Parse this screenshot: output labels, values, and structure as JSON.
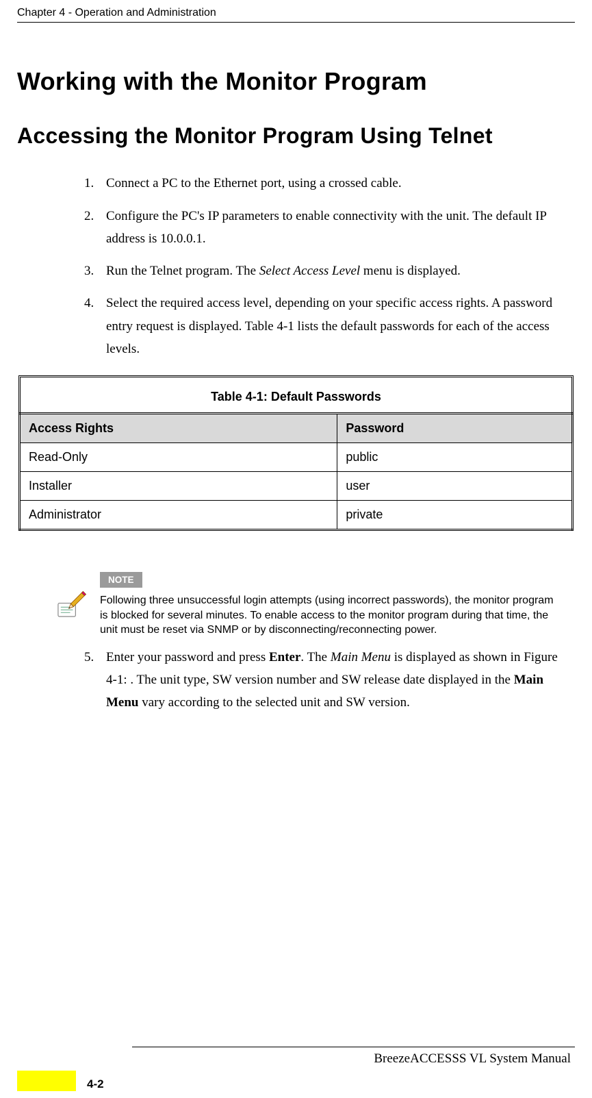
{
  "header": {
    "chapter": "Chapter 4 - Operation and Administration"
  },
  "titles": {
    "h1": "Working with the Monitor Program",
    "h2": "Accessing the Monitor Program Using Telnet"
  },
  "list1": {
    "item1": {
      "num": "1.",
      "text": "Connect a PC to the Ethernet port, using a crossed cable."
    },
    "item2": {
      "num": "2.",
      "text": "Configure the PC's IP parameters to enable connectivity with the unit. The default IP address is 10.0.0.1."
    },
    "item3": {
      "num": "3.",
      "pre": "Run the Telnet program. The ",
      "italic": "Select Access Level",
      "post": " menu is displayed."
    },
    "item4": {
      "num": "4.",
      "text": "Select the required access level, depending on your specific access rights. A password entry request is displayed. Table 4-1 lists the default passwords for each of the access levels."
    }
  },
  "table": {
    "caption": "Table 4-1: Default Passwords",
    "headers": {
      "col1": "Access Rights",
      "col2": "Password"
    },
    "rows": [
      {
        "col1": "Read-Only",
        "col2": "public"
      },
      {
        "col1": "Installer",
        "col2": "user"
      },
      {
        "col1": "Administrator",
        "col2": "private"
      }
    ]
  },
  "note": {
    "tag": "NOTE",
    "text": "Following three unsuccessful login attempts (using incorrect passwords), the monitor program is blocked for several minutes. To enable access to the monitor program during that time, the unit must be reset via SNMP or by disconnecting/reconnecting power."
  },
  "list2": {
    "item5": {
      "num": "5.",
      "p1": "Enter your password and press ",
      "b1": "Enter",
      "p2": ". The ",
      "i1": "Main Menu",
      "p3": " is displayed as shown in Figure 4-1: . The unit type, SW version number and SW release date displayed in the ",
      "b2": "Main Menu",
      "p4": " vary according to the selected unit and SW version."
    }
  },
  "footer": {
    "title": "BreezeACCESSS VL System Manual",
    "page": "4-2"
  }
}
